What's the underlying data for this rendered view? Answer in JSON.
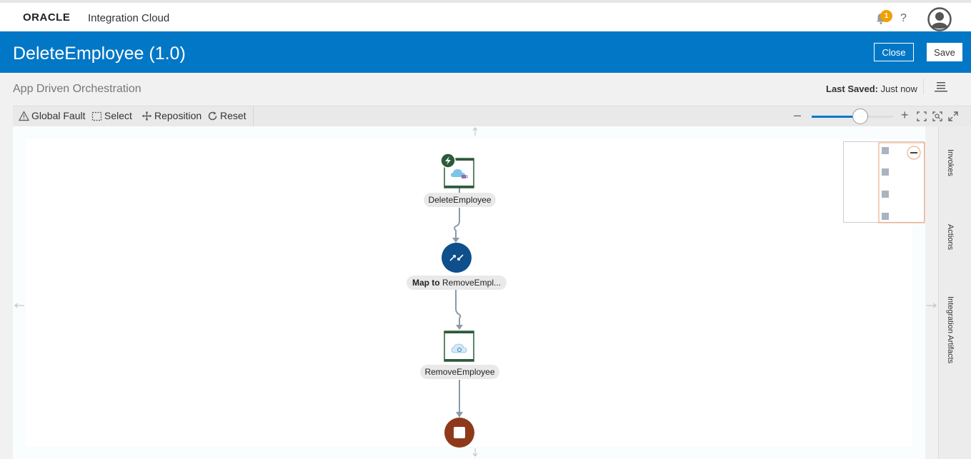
{
  "header": {
    "logo_text": "ORACLE",
    "product_name": "Integration Cloud",
    "notification_count": "1",
    "help_label": "?"
  },
  "titlebar": {
    "title": "DeleteEmployee (1.0)",
    "close_label": "Close",
    "save_label": "Save"
  },
  "subheader": {
    "integration_style": "App Driven Orchestration",
    "last_saved_label": "Last Saved:",
    "last_saved_value": "Just now"
  },
  "toolbar": {
    "global_fault_label": "Global Fault",
    "select_label": "Select",
    "reposition_label": "Reposition",
    "reset_label": "Reset",
    "zoom_level": 0.6
  },
  "side_tabs": {
    "invokes": "Invokes",
    "actions": "Actions",
    "integration_artifacts": "Integration Artifacts"
  },
  "flow": {
    "trigger_label": "DeleteEmployee",
    "map_label_prefix": "Map to",
    "map_label_target": "RemoveEmpl...",
    "invoke_label": "RemoveEmployee"
  },
  "colors": {
    "brand_blue": "#0277c6",
    "trigger_green": "#2d5a3a",
    "map_blue": "#0e4f8c",
    "stop_brown": "#8e3a1a",
    "badge_orange": "#f0a000"
  },
  "icons": {
    "trigger_badge": "lightning-icon",
    "map": "map-arrows-icon",
    "stop": "stop-icon",
    "notification": "bell-icon",
    "avatar": "user-avatar-icon",
    "menu": "hamburger-menu-icon"
  }
}
